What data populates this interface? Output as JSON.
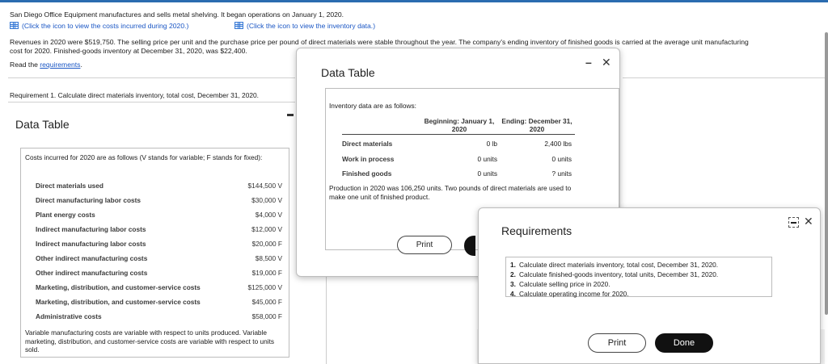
{
  "problem": {
    "intro": "San Diego Office Equipment manufactures and sells metal shelving. It began operations on January 1, 2020.",
    "costs_link": "(Click the icon to view the costs incurred during 2020.)",
    "inventory_link": "(Click the icon to view the inventory data.)",
    "revenue_line1": "Revenues in 2020 were $519,750. The selling price per unit and the purchase price per pound of direct materials were stable throughout the year. The company's ending inventory of finished goods is carried at the average unit manufacturing",
    "revenue_line2": "cost for 2020. Finished-goods inventory at December 31, 2020, was $22,400.",
    "read_prefix": "Read the",
    "read_link": "requirements",
    "read_suffix": ".",
    "requirement1": "Requirement 1. Calculate direct materials inventory, total cost, December 31, 2020."
  },
  "costs_panel": {
    "title": "Data Table",
    "intro": "Costs incurred for 2020 are as follows (V stands for variable; F stands for fixed):",
    "rows": [
      {
        "label": "Direct materials used",
        "amount": "$144,500 V"
      },
      {
        "label": "Direct manufacturing labor costs",
        "amount": "$30,000 V"
      },
      {
        "label": "Plant energy costs",
        "amount": "$4,000 V"
      },
      {
        "label": "Indirect manufacturing labor costs",
        "amount": "$12,000 V"
      },
      {
        "label": "Indirect manufacturing labor costs",
        "amount": "$20,000 F"
      },
      {
        "label": "Other indirect manufacturing costs",
        "amount": "$8,500 V"
      },
      {
        "label": "Other indirect manufacturing costs",
        "amount": "$19,000 F"
      },
      {
        "label": "Marketing, distribution, and customer-service costs",
        "amount": "$125,000 V"
      },
      {
        "label": "Marketing, distribution, and customer-service costs",
        "amount": "$45,000 F"
      },
      {
        "label": "Administrative costs",
        "amount": "$58,000 F"
      }
    ],
    "footer": "Variable manufacturing costs are variable with respect to units produced. Variable marketing, distribution, and customer-service costs are variable with respect to units sold."
  },
  "inventory_dialog": {
    "title": "Data Table",
    "minimize": "–",
    "close": "✕",
    "intro": "Inventory data are as follows:",
    "col_begin": "Beginning: January 1, 2020",
    "col_end": "Ending: December 31, 2020",
    "rows": [
      {
        "label": "Direct materials",
        "begin": "0 lb",
        "end": "2,400 lbs"
      },
      {
        "label": "Work in process",
        "begin": "0 units",
        "end": "0 units"
      },
      {
        "label": "Finished goods",
        "begin": "0 units",
        "end": "? units"
      }
    ],
    "production_note": "Production in 2020 was 106,250 units. Two pounds of direct materials are used to make one unit of finished product.",
    "print_label": "Print"
  },
  "requirements_dialog": {
    "title": "Requirements",
    "close": "✕",
    "items": [
      {
        "num": "1.",
        "text": "Calculate direct materials inventory, total cost, December 31, 2020."
      },
      {
        "num": "2.",
        "text": "Calculate finished-goods inventory, total units, December 31, 2020."
      },
      {
        "num": "3.",
        "text": "Calculate selling price in 2020."
      },
      {
        "num": "4.",
        "text": "Calculate operating income for 2020."
      }
    ],
    "print_label": "Print",
    "done_label": "Done"
  }
}
